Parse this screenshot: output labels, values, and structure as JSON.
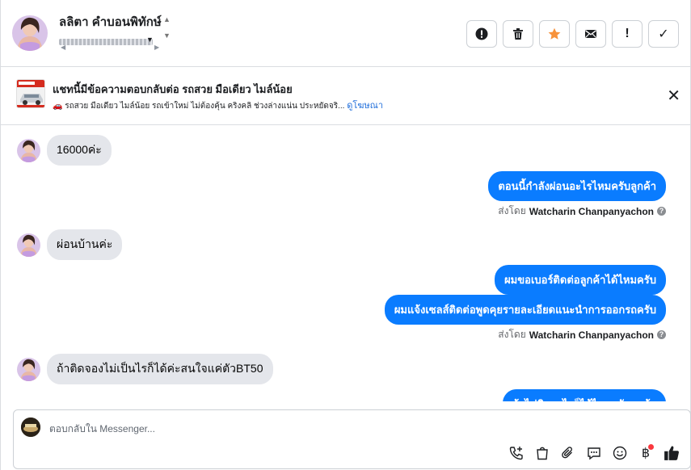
{
  "header": {
    "contact_name": "ลลิตา คำบอนพิทักษ์",
    "toolbar": [
      {
        "name": "spam-icon",
        "title": "alert-circle"
      },
      {
        "name": "trash-icon",
        "title": "delete"
      },
      {
        "name": "star-icon",
        "title": "star"
      },
      {
        "name": "mail-icon",
        "title": "mark-unread"
      },
      {
        "name": "exclamation-icon",
        "title": "follow-up",
        "glyph": "!"
      },
      {
        "name": "check-icon",
        "title": "done",
        "glyph": "✓"
      }
    ],
    "star_color": "#f7923a"
  },
  "ad": {
    "title": "แชทนี้มีข้อความตอบกลับต่อ รถสวย มือเดียว ไมล์น้อย",
    "description": "🚗 รถสวย มือเดียว ไมล์น้อย รถเข้าใหม่ ไม่ต้องคุ้น คริงคลิ ช่วงล่างแน่น ประหยัดจริ...",
    "link": "ดูโฆษณา",
    "close": "✕"
  },
  "conversation": {
    "sender_label": "ส่งโดย",
    "sender_name": "Watcharin Chanpanyachon",
    "messages": [
      {
        "dir": "in",
        "text": "16000ค่ะ"
      },
      {
        "dir": "out",
        "text": "ตอนนี้กำลังผ่อนอะไรไหมครับลูกค้า"
      },
      {
        "dir": "in",
        "text": "ผ่อนบ้านค่ะ"
      },
      {
        "dir": "out",
        "text": "ผมขอเบอร์ติดต่อลูกค้าได้ไหมครับ"
      },
      {
        "dir": "out",
        "text": "ผมแจ้งเซลส์ติดต่อพูดคุยรายละเอียดแนะนำการออกรถครับ"
      },
      {
        "dir": "in",
        "text": "ถ้าติดจองไม่เป็นไรก็ได้ค่ะสนใจแค่ตัวBT50"
      },
      {
        "dir": "out",
        "text": "ถ้าไม่ติดอะไรก็ได้ไหมครับลูกค้า"
      }
    ],
    "bubble_color": "#0a7cff"
  },
  "composer": {
    "placeholder": "ตอบกลับใน Messenger...",
    "tools": [
      "call-add-icon",
      "bag-icon",
      "attachment-icon",
      "saved-reply-icon",
      "emoji-icon",
      "baht-icon",
      "like-icon"
    ],
    "notification_color": "#fa383e"
  }
}
